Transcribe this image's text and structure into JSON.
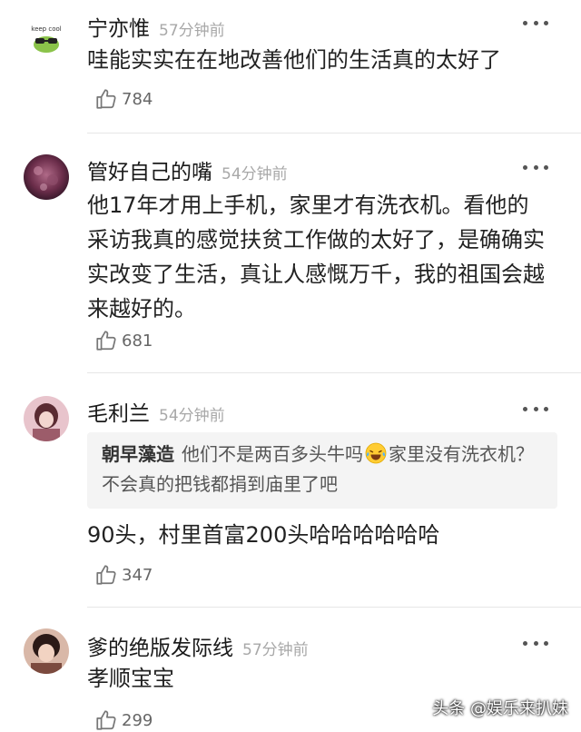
{
  "comments": [
    {
      "name": "宁亦惟",
      "time": "57分钟前",
      "avatar_text": "keep cool",
      "text": "哇能实实在在地改善他们的生活真的太好了",
      "likes": "784"
    },
    {
      "name": "管好自己的嘴",
      "time": "54分钟前",
      "text": "他17年才用上手机，家里才有洗衣机。看他的采访我真的感觉扶贫工作做的太好了，是确确实实改变了生活，真让人感慨万千，我的祖国会越来越好的。",
      "likes": "681"
    },
    {
      "name": "毛利兰",
      "time": "54分钟前",
      "quote": {
        "name": "朝早藻造",
        "text_before": "他们不是两百多头牛吗",
        "emoji": "laughing-tears-emoji",
        "text_after": "家里没有洗衣机？不会真的把钱都捐到庙里了吧"
      },
      "text": "90头，村里首富200头哈哈哈哈哈哈",
      "likes": "347"
    },
    {
      "name": "爹的绝版发际线",
      "time": "57分钟前",
      "text": "孝顺宝宝",
      "likes": "299"
    }
  ],
  "watermark": "头条 @娱乐来扒妹",
  "icons": {
    "like": "thumbs-up-icon",
    "more": "more-dots-icon"
  },
  "colors": {
    "time": "#a8a8a8",
    "divider": "#e6e6e6",
    "quote_bg": "#f4f4f4"
  }
}
